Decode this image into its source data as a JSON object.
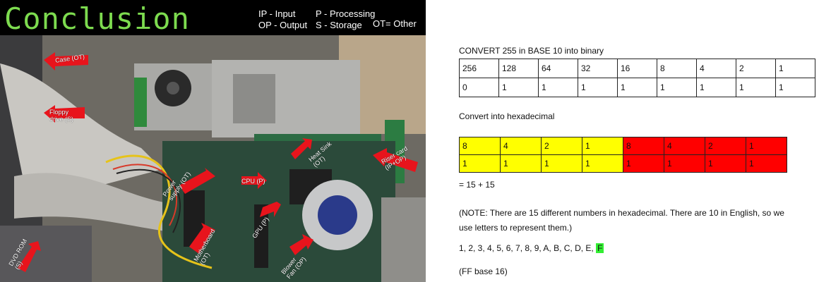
{
  "slide": {
    "title": "Conclusion",
    "legend": {
      "ip": "IP - Input",
      "op": "OP - Output",
      "p": "P - Processing",
      "s": "S - Storage",
      "ot": "OT= Other"
    },
    "labels": {
      "case": "Case (OT)",
      "floppy": "Floppy drive (S)",
      "power": "Power supply (OT)",
      "dvd": "DVD ROM (S)",
      "cpu": "CPU (P)",
      "gpu": "GPU (P)",
      "heatsink": "Heat Sink (OT)",
      "riser": "Riser card (IP+OP)",
      "motherboard": "Motherboard (OT)",
      "blower": "Blower Fan (OP)"
    },
    "colors": {
      "title": "#7ddb4f",
      "arrow": "#e8141c"
    }
  },
  "doc": {
    "binary_heading": "CONVERT 255 in BASE 10 into binary",
    "binary_table": [
      [
        "256",
        "128",
        "64",
        "32",
        "16",
        "8",
        "4",
        "2",
        "1"
      ],
      [
        "0",
        "1",
        "1",
        "1",
        "1",
        "1",
        "1",
        "1",
        "1"
      ]
    ],
    "hex_heading": "Convert into hexadecimal",
    "hex_table": [
      [
        "8",
        "4",
        "2",
        "1",
        "8",
        "4",
        "2",
        "1"
      ],
      [
        "1",
        "1",
        "1",
        "1",
        "1",
        "1",
        "1",
        "1"
      ]
    ],
    "sum": "= 15 + 15",
    "note": "(NOTE: There are 15 different numbers in hexadecimal. There are 10 in English, so we use letters to represent them.)",
    "digits": "1, 2, 3, 4, 5, 6, 7, 8, 9, A, B, C, D, E,",
    "digits_highlight": "F",
    "result": "(FF base 16)",
    "colors": {
      "yellow": "#ffff00",
      "red": "#ff0000",
      "highlight": "#33ee33"
    }
  }
}
